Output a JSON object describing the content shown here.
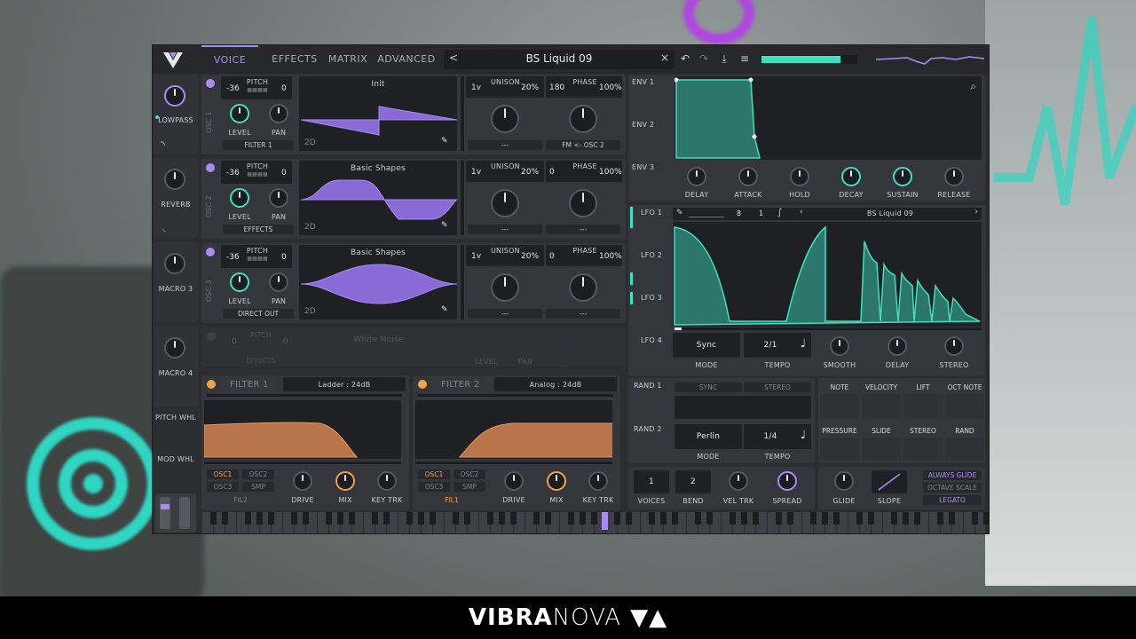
{
  "brand": {
    "bold": "VIBRA",
    "light": "NOVA"
  },
  "topbar": {
    "tabs": [
      "VOICE",
      "EFFECTS",
      "MATRIX",
      "ADVANCED"
    ],
    "active_tab": "VOICE",
    "preset_name": "BS Liquid 09",
    "prev_arrow": "<",
    "next_arrow": "×",
    "output_level_fraction": 0.82
  },
  "sidebar": {
    "items": [
      {
        "label": "LOWPASS"
      },
      {
        "label": "REVERB"
      },
      {
        "label": "MACRO 3"
      },
      {
        "label": "MACRO 4"
      },
      {
        "label": "PITCH WHL"
      },
      {
        "label": "MOD WHL"
      }
    ]
  },
  "oscillators": [
    {
      "id": "OSC 1",
      "pitch_label": "PITCH",
      "octave": "-36",
      "semi": "0",
      "level": "LEVEL",
      "pan": "PAN",
      "route": "FILTER 1",
      "wave": "Init",
      "mode": "2D",
      "voices": "1v",
      "unison": "UNISON",
      "detune": "20%",
      "phase_value": "180",
      "phase": "PHASE",
      "phase_pct": "100%",
      "mod_left": "---",
      "mod_right": "FM <- OSC 2"
    },
    {
      "id": "OSC 2",
      "pitch_label": "PITCH",
      "octave": "-36",
      "semi": "0",
      "level": "LEVEL",
      "pan": "PAN",
      "route": "EFFECTS",
      "wave": "Basic Shapes",
      "mode": "2D",
      "voices": "1v",
      "unison": "UNISON",
      "detune": "20%",
      "phase_value": "0",
      "phase": "PHASE",
      "phase_pct": "100%",
      "mod_left": "---",
      "mod_right": "---"
    },
    {
      "id": "OSC 3",
      "pitch_label": "PITCH",
      "octave": "-36",
      "semi": "0",
      "level": "LEVEL",
      "pan": "PAN",
      "route": "DIRECT OUT",
      "wave": "Basic Shapes",
      "mode": "2D",
      "voices": "1v",
      "unison": "UNISON",
      "detune": "20%",
      "phase_value": "0",
      "phase": "PHASE",
      "phase_pct": "100%",
      "mod_left": "---",
      "mod_right": "---"
    }
  ],
  "sampler": {
    "pitch": "PITCH",
    "octave": "0",
    "semi": "0",
    "route": "EFFECTS",
    "wave": "White Noise",
    "level": "LEVEL",
    "pan": "PAN"
  },
  "filters": [
    {
      "name": "FILTER 1",
      "type": "Ladder : 24dB",
      "osc1": "OSC1",
      "osc2": "OSC2",
      "osc3": "OSC3",
      "smp": "SMP",
      "chain": "FIL2",
      "drive": "DRIVE",
      "mix": "MIX",
      "keytrk": "KEY TRK"
    },
    {
      "name": "FILTER 2",
      "type": "Analog : 24dB",
      "osc1": "OSC1",
      "osc2": "OSC2",
      "osc3": "OSC3",
      "smp": "SMP",
      "chain": "FIL1",
      "drive": "DRIVE",
      "mix": "MIX",
      "keytrk": "KEY TRK"
    }
  ],
  "envelopes": {
    "tabs": [
      "ENV 1",
      "ENV 2",
      "ENV 3"
    ],
    "knobs": [
      "DELAY",
      "ATTACK",
      "HOLD",
      "DECAY",
      "SUSTAIN",
      "RELEASE"
    ]
  },
  "lfo": {
    "tabs": [
      "LFO 1",
      "LFO 2",
      "LFO 3",
      "LFO 4"
    ],
    "grid_x": "8",
    "grid_y": "1",
    "preset": "BS Liquid 09",
    "mode_value": "Sync",
    "mode_label": "MODE",
    "tempo_value": "2/1",
    "tempo_label": "TEMPO",
    "knobs": [
      "SMOOTH",
      "DELAY",
      "STEREO"
    ]
  },
  "random": {
    "tabs": [
      "RAND 1",
      "RAND 2"
    ],
    "sync": "SYNC",
    "stereo": "STEREO",
    "mode_value": "Perlin",
    "mode_label": "MODE",
    "tempo_value": "1/4",
    "tempo_label": "TEMPO"
  },
  "mod_sources": {
    "row1": [
      "NOTE",
      "VELOCITY",
      "LIFT",
      "OCT NOTE"
    ],
    "row2": [
      "PRESSURE",
      "SLIDE",
      "STEREO",
      "RAND"
    ]
  },
  "voice_settings": {
    "voices_value": "1",
    "voices_label": "VOICES",
    "bend_value": "2",
    "bend_label": "BEND",
    "veltrk": "VEL TRK",
    "spread": "SPREAD",
    "glide": "GLIDE",
    "slope": "SLOPE",
    "always_glide": "ALWAYS GLIDE",
    "octave_scale": "OCTAVE SCALE",
    "legato": "LEGATO"
  },
  "colors": {
    "accent": "#a88cf2",
    "teal": "#3ee0c0",
    "orange": "#f0a24a",
    "filter_fill": "#b9744a"
  }
}
